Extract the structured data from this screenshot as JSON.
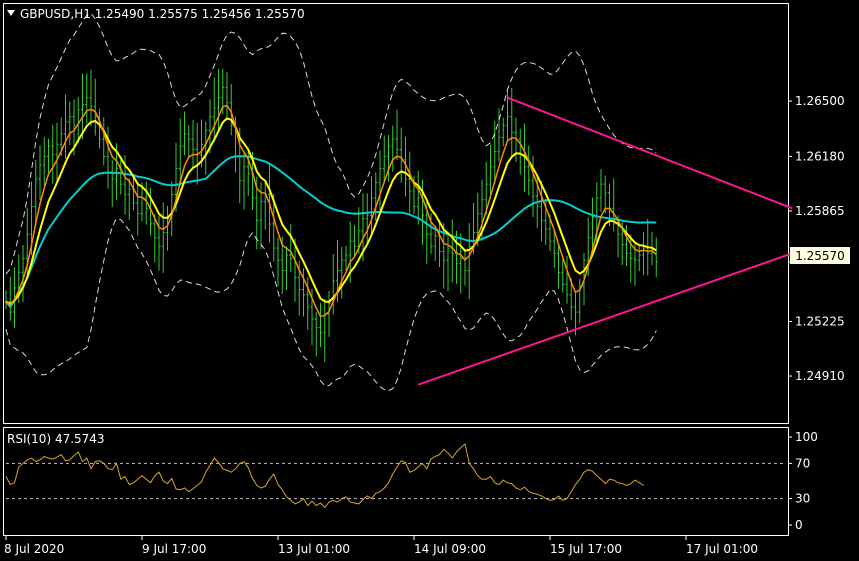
{
  "header": {
    "menu_icon": "triangle-down-icon",
    "title": "GBPUSD,H1  1.25490 1.25575 1.25456 1.25570"
  },
  "current_price_label": "1.25570",
  "colors": {
    "background": "#000000",
    "frame": "#ffffff",
    "candle": "#32cd32",
    "ma_fast": "#ff8c00",
    "ma_slow": "#ffff00",
    "ma_long": "#00ced1",
    "bands": "#ffffff",
    "triangle": "#ff1493",
    "rsi": "#daa520",
    "price_tag_bg": "#ffffe0"
  },
  "chart_data": [
    {
      "type": "line",
      "pair": "GBPUSD",
      "timeframe": "H1",
      "title": "GBPUSD,H1",
      "ylim": [
        1.2465,
        1.2705
      ],
      "y_ticks": [
        "1.26500",
        "1.26180",
        "1.25865",
        "1.25570",
        "1.25225",
        "1.24910"
      ],
      "y_tick_values": [
        1.265,
        1.2618,
        1.25865,
        1.2557,
        1.25225,
        1.2491
      ],
      "x_tick_labels": [
        "8 Jul 2020",
        "9 Jul 17:00",
        "13 Jul 01:00",
        "14 Jul 09:00",
        "15 Jul 17:00",
        "17 Jul 01:00"
      ],
      "x_tick_bar_index": [
        0,
        32,
        64,
        96,
        128,
        160
      ],
      "last_ohlc": {
        "open": 1.2549,
        "high": 1.25575,
        "low": 1.25456,
        "close": 1.2557
      },
      "close_series": [
        1.2534,
        1.2528,
        1.2542,
        1.2551,
        1.2559,
        1.2573,
        1.2589,
        1.2605,
        1.2613,
        1.2618,
        1.2624,
        1.2619,
        1.2625,
        1.2631,
        1.2638,
        1.2641,
        1.2636,
        1.2645,
        1.2648,
        1.2652,
        1.2647,
        1.2641,
        1.2628,
        1.2618,
        1.2609,
        1.2605,
        1.2611,
        1.2602,
        1.2596,
        1.2599,
        1.2591,
        1.2585,
        1.2594,
        1.2588,
        1.2579,
        1.2571,
        1.2566,
        1.2574,
        1.2582,
        1.2596,
        1.2611,
        1.2624,
        1.2631,
        1.2628,
        1.2622,
        1.2619,
        1.2625,
        1.2633,
        1.2641,
        1.2646,
        1.2652,
        1.2658,
        1.2649,
        1.2636,
        1.2618,
        1.2604,
        1.2612,
        1.2608,
        1.2594,
        1.2581,
        1.2592,
        1.2596,
        1.2579,
        1.2565,
        1.2558,
        1.2552,
        1.2561,
        1.2559,
        1.2548,
        1.2541,
        1.2538,
        1.2531,
        1.2524,
        1.2519,
        1.2516,
        1.2527,
        1.2533,
        1.2546,
        1.2552,
        1.2558,
        1.2561,
        1.2569,
        1.2566,
        1.2575,
        1.2582,
        1.2584,
        1.2594,
        1.2603,
        1.2611,
        1.2618,
        1.2624,
        1.2628,
        1.2622,
        1.2616,
        1.2605,
        1.2598,
        1.2589,
        1.2594,
        1.2584,
        1.2573,
        1.2566,
        1.2572,
        1.2563,
        1.2558,
        1.2565,
        1.2562,
        1.2556,
        1.2559,
        1.2552,
        1.2566,
        1.2574,
        1.2585,
        1.2593,
        1.2602,
        1.2612,
        1.2621,
        1.2629,
        1.2636,
        1.2641,
        1.2632,
        1.2628,
        1.2619,
        1.2612,
        1.2604,
        1.2595,
        1.2589,
        1.2581,
        1.2576,
        1.2569,
        1.2562,
        1.2551,
        1.2544,
        1.2538,
        1.2531,
        1.2528,
        1.2543,
        1.2558,
        1.2571,
        1.2583,
        1.2594,
        1.2602,
        1.2597,
        1.2588,
        1.2579,
        1.2573,
        1.2567,
        1.2562,
        1.2559,
        1.2558,
        1.2561,
        1.2565,
        1.2562,
        1.2564,
        1.2557
      ],
      "annotations": {
        "triangle_upper": [
          [
            1.2652,
            118
          ],
          [
            1.2588,
            185
          ]
        ],
        "triangle_lower": [
          [
            1.2486,
            97
          ],
          [
            1.2562,
            185
          ]
        ]
      }
    },
    {
      "type": "line",
      "title": "RSI(10) 47.5743",
      "indicator": "RSI(10)",
      "last_value": 47.5743,
      "ylim": [
        0,
        100
      ],
      "y_ticks": [
        100,
        70,
        30,
        0
      ],
      "levels": [
        70,
        30
      ],
      "values": [
        55,
        46,
        48,
        66,
        70,
        74,
        76,
        72,
        74,
        78,
        76,
        75,
        77,
        80,
        73,
        74,
        79,
        83,
        72,
        76,
        64,
        72,
        73,
        70,
        64,
        63,
        70,
        52,
        55,
        46,
        48,
        52,
        56,
        52,
        48,
        56,
        60,
        50,
        47,
        53,
        41,
        40,
        42,
        38,
        41,
        45,
        49,
        60,
        68,
        76,
        71,
        64,
        62,
        60,
        64,
        70,
        72,
        65,
        53,
        45,
        42,
        44,
        52,
        58,
        46,
        40,
        32,
        28,
        24,
        26,
        30,
        22,
        27,
        22,
        25,
        20,
        26,
        28,
        26,
        30,
        32,
        26,
        25,
        24,
        29,
        33,
        30,
        36,
        38,
        42,
        48,
        58,
        66,
        73,
        71,
        60,
        62,
        66,
        70,
        64,
        75,
        78,
        80,
        86,
        82,
        76,
        83,
        88,
        92,
        70,
        64,
        56,
        52,
        52,
        55,
        48,
        46,
        51,
        48,
        47,
        42,
        40,
        43,
        38,
        36,
        35,
        33,
        30,
        28,
        29,
        33,
        28,
        30,
        38,
        46,
        52,
        60,
        63,
        61,
        56,
        52,
        47,
        52,
        51,
        48,
        47,
        45,
        47,
        51,
        48,
        45
      ]
    }
  ]
}
